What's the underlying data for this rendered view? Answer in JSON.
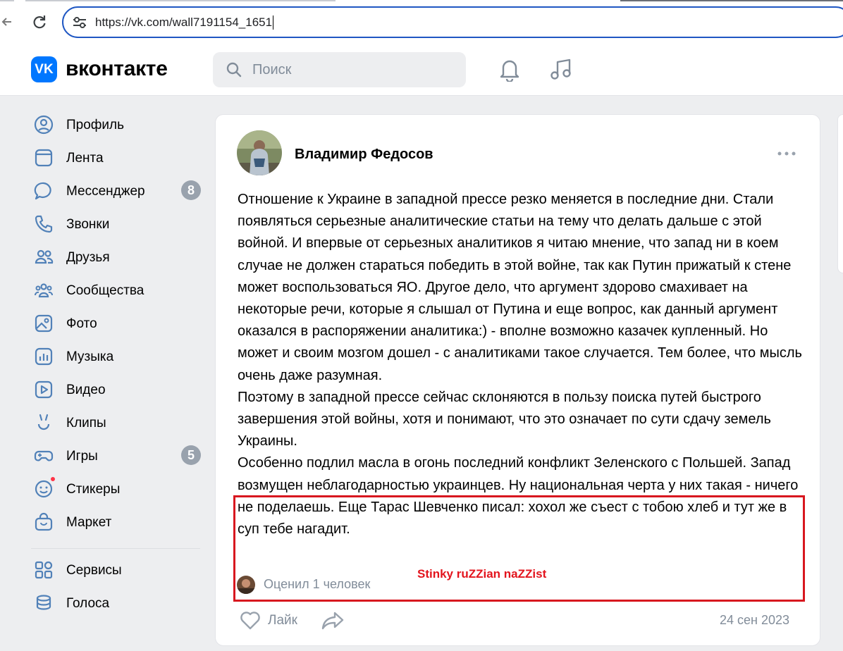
{
  "browser": {
    "url": "https://vk.com/wall7191154_1651"
  },
  "header": {
    "logo_text": "VK",
    "brand": "вконтакте",
    "search_placeholder": "Поиск"
  },
  "sidebar": {
    "items": [
      {
        "label": "Профиль",
        "icon": "profile-icon"
      },
      {
        "label": "Лента",
        "icon": "feed-icon"
      },
      {
        "label": "Мессенджер",
        "icon": "messenger-icon",
        "badge": "8"
      },
      {
        "label": "Звонки",
        "icon": "phone-icon"
      },
      {
        "label": "Друзья",
        "icon": "friends-icon"
      },
      {
        "label": "Сообщества",
        "icon": "communities-icon"
      },
      {
        "label": "Фото",
        "icon": "photo-icon"
      },
      {
        "label": "Музыка",
        "icon": "music-icon"
      },
      {
        "label": "Видео",
        "icon": "video-icon"
      },
      {
        "label": "Клипы",
        "icon": "clips-icon"
      },
      {
        "label": "Игры",
        "icon": "games-icon",
        "badge": "5"
      },
      {
        "label": "Стикеры",
        "icon": "stickers-icon"
      },
      {
        "label": "Маркет",
        "icon": "market-icon"
      },
      {
        "label": "Сервисы",
        "icon": "services-icon"
      },
      {
        "label": "Голоса",
        "icon": "votes-icon"
      }
    ]
  },
  "post": {
    "author": "Владимир Федосов",
    "paragraphs": [
      "Отношение к Украине в западной прессе резко меняется в последние дни. Стали появляться серьезные аналитические статьи на тему что делать дальше с этой войной. И впервые от серьезных аналитиков я читаю мнение, что запад ни в коем случае не должен стараться победить в этой войне, так как Путин прижатый к стене может воспользоваться ЯО. Другое дело, что аргумент здорово смахивает на некоторые речи, которые я слышал от Путина и еще вопрос, как данный аргумент оказался в распоряжении аналитика:) - вполне возможно казачек купленный. Но может и своим мозгом дошел - с аналитиками такое случается. Тем более, что мысль очень даже разумная.",
      "Поэтому в западной прессе сейчас склоняются в пользу поиска путей быстрого завершения этой войны, хотя и понимают, что это означает по сути сдачу земель Украины.",
      "Особенно подлил масла в огонь последний конфликт Зеленского с Польшей. Запад возмущен неблагодарностью украинцев. Ну национальная черта у них такая - ничего не поделаешь. Еще Тарас Шевченко писал: хохол же съест с тобою хлеб и тут же в суп тебе нагадит."
    ],
    "liked_by": "Оценил 1 человек",
    "like_label": "Лайк",
    "date": "24 сен 2023"
  },
  "annotation": {
    "stamp_text": "Stinky ruZZian naZZist",
    "box_color": "#d8171f"
  },
  "colors": {
    "brand": "#0077ff",
    "muted": "#818c99",
    "background": "#edeef0"
  }
}
